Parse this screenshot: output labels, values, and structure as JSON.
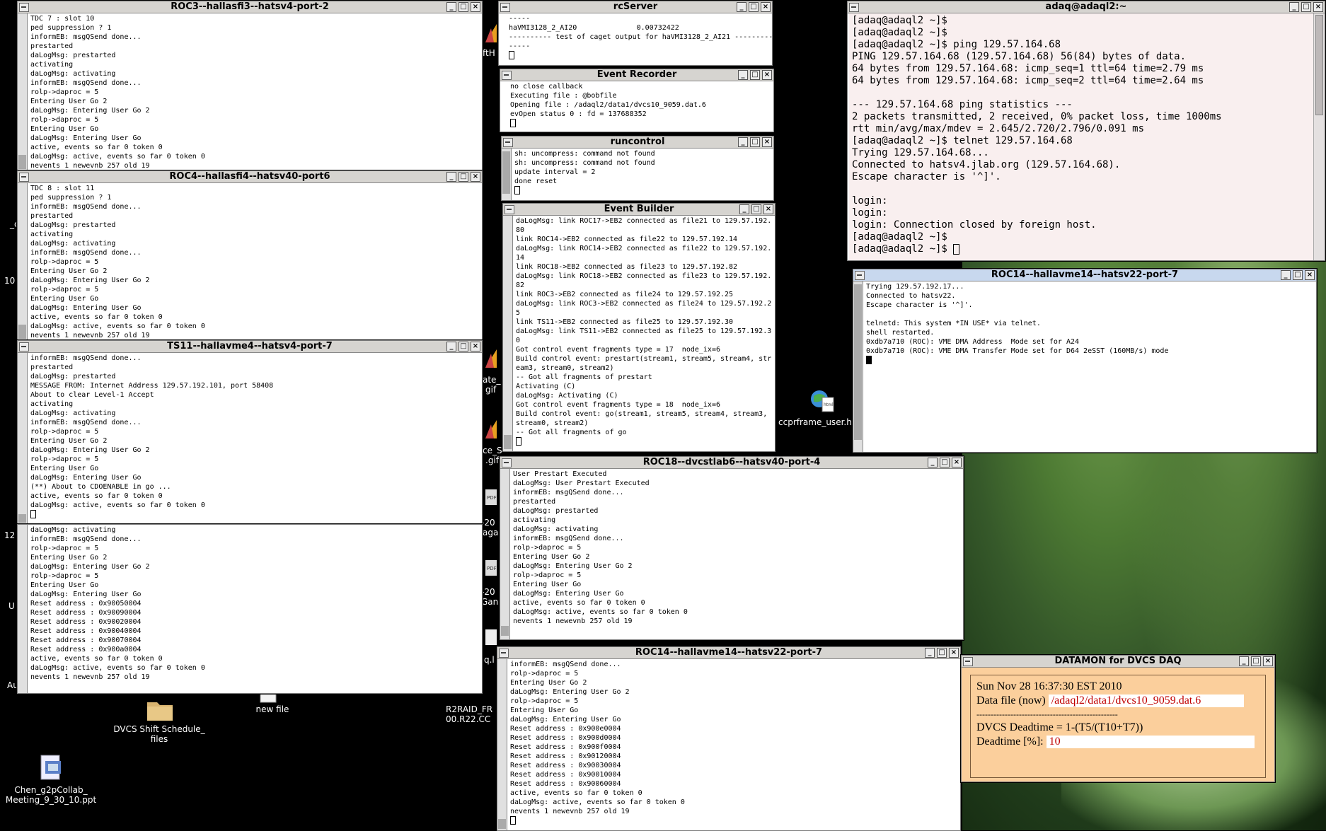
{
  "desktop": {
    "icons": [
      {
        "label": "DVCS Shift Schedule_\nfiles",
        "icon": "folder-icon"
      },
      {
        "label": "new file",
        "icon": "file-icon"
      },
      {
        "label": "Chen_g2pCollab_\nMeeting_9_30_10.ppt",
        "icon": "ppt-icon"
      },
      {
        "label": "ccprframe_user.h",
        "icon": "html-file-icon"
      },
      {
        "label": "R2RAID_FR\n00.R22.CC",
        "icon": "file-icon"
      }
    ],
    "partial_labels": [
      "ftH",
      "_c",
      "10",
      "12",
      "U",
      "Au",
      "ate_",
      "gif",
      "ce_S",
      ".gif",
      "-20",
      "aga",
      "-20",
      "Gan",
      "q.l"
    ]
  },
  "roc3": {
    "title": "ROC3--hallasfi3--hatsv4-port-2",
    "lines": "TDC 7 : slot 10\nped suppression ? 1\ninformEB: msgQSend done...\nprestarted\ndaLogMsg: prestarted\nactivating\ndaLogMsg: activating\ninformEB: msgQSend done...\nrolp->daproc = 5\nEntering User Go 2\ndaLogMsg: Entering User Go 2\nrolp->daproc = 5\nEntering User Go\ndaLogMsg: Entering User Go\nactive, events so far 0 token 0\ndaLogMsg: active, events so far 0 token 0\nnevents 1 newevnb 257 old 19"
  },
  "roc4": {
    "title": "ROC4--hallasfi4--hatsv40-port6",
    "lines": "TDC 8 : slot 11\nped suppression ? 1\ninformEB: msgQSend done...\nprestarted\ndaLogMsg: prestarted\nactivating\ndaLogMsg: activating\ninformEB: msgQSend done...\nrolp->daproc = 5\nEntering User Go 2\ndaLogMsg: Entering User Go 2\nrolp->daproc = 5\nEntering User Go\ndaLogMsg: Entering User Go\nactive, events so far 0 token 0\ndaLogMsg: active, events so far 0 token 0\nnevents 1 newevnb 257 old 19"
  },
  "ts11": {
    "title": "TS11--hallavme4--hatsv4-port-7",
    "lines": "informEB: msgQSend done...\nprestarted\ndaLogMsg: prestarted\nMESSAGE FROM: Internet Address 129.57.192.101, port 58408\nAbout to clear Level-1 Accept\nactivating\ndaLogMsg: activating\ninformEB: msgQSend done...\nrolp->daproc = 5\nEntering User Go 2\ndaLogMsg: Entering User Go 2\nrolp->daproc = 5\nEntering User Go\ndaLogMsg: Entering User Go\n(**) About to CDOENABLE in go ...\nactive, events so far 0 token 0\ndaLogMsg: active, events so far 0 token 0"
  },
  "lowerleft": {
    "lines": "daLogMsg: activating\ninformEB: msgQSend done...\nrolp->daproc = 5\nEntering User Go 2\ndaLogMsg: Entering User Go 2\nrolp->daproc = 5\nEntering User Go\ndaLogMsg: Entering User Go\nReset address : 0x90050004\nReset address : 0x90090004\nReset address : 0x90020004\nReset address : 0x90040004\nReset address : 0x90070004\nReset address : 0x900a0004\nactive, events so far 0 token 0\ndaLogMsg: active, events so far 0 token 0\nnevents 1 newevnb 257 old 19"
  },
  "rcserver": {
    "title": "rcServer",
    "lines": "-----\nhaVMI3128_2_AI20              0.00732422\n---------- test of caget output for haVMI3128_2_AI21 ---------\n-----"
  },
  "recorder": {
    "title": "Event Recorder",
    "lines": "no close callback\nExecuting file : @bobfile\nOpening file : /adaql2/data1/dvcs10_9059.dat.6\nevOpen status 0 : fd = 137688352"
  },
  "runcontrol": {
    "title": "runcontrol",
    "lines": "sh: uncompress: command not found\nsh: uncompress: command not found\nupdate interval = 2\ndone reset"
  },
  "eb": {
    "title": "Event Builder",
    "lines": "daLogMsg: link ROC17->EB2 connected as file21 to 129.57.192.\n80\nlink ROC14->EB2 connected as file22 to 129.57.192.14\ndaLogMsg: link ROC14->EB2 connected as file22 to 129.57.192.\n14\nlink ROC18->EB2 connected as file23 to 129.57.192.82\ndaLogMsg: link ROC18->EB2 connected as file23 to 129.57.192.\n82\nlink ROC3->EB2 connected as file24 to 129.57.192.25\ndaLogMsg: link ROC3->EB2 connected as file24 to 129.57.192.2\n5\nlink TS11->EB2 connected as file25 to 129.57.192.30\ndaLogMsg: link TS11->EB2 connected as file25 to 129.57.192.3\n0\nGot control event fragments type = 17  node_ix=6\nBuild control event: prestart(stream1, stream5, stream4, str\neam3, stream0, stream2)\n-- Got all fragments of prestart\nActivating (C)\ndaLogMsg: Activating (C)\nGot control event fragments type = 18  node_ix=6\nBuild control event: go(stream1, stream5, stream4, stream3,\nstream0, stream2)\n-- Got all fragments of go"
  },
  "roc18": {
    "title": "ROC18--dvcstlab6--hatsv40-port-4",
    "lines": "User Prestart Executed\ndaLogMsg: User Prestart Executed\ninformEB: msgQSend done...\nprestarted\ndaLogMsg: prestarted\nactivating\ndaLogMsg: activating\ninformEB: msgQSend done...\nrolp->daproc = 5\nEntering User Go 2\ndaLogMsg: Entering User Go 2\nrolp->daproc = 5\nEntering User Go\ndaLogMsg: Entering User Go\nactive, events so far 0 token 0\ndaLogMsg: active, events so far 0 token 0\nnevents 1 newevnb 257 old 19"
  },
  "roc14b": {
    "title": "ROC14--hallavme14--hatsv22-port-7",
    "lines": "informEB: msgQSend done...\nrolp->daproc = 5\nEntering User Go 2\ndaLogMsg: Entering User Go 2\nrolp->daproc = 5\nEntering User Go\ndaLogMsg: Entering User Go\nReset address : 0x900e0004\nReset address : 0x900d0004\nReset address : 0x900f0004\nReset address : 0x90120004\nReset address : 0x90030004\nReset address : 0x90010004\nReset address : 0x90060004\nactive, events so far 0 token 0\ndaLogMsg: active, events so far 0 token 0\nnevents 1 newevnb 257 old 19"
  },
  "adaq": {
    "title": "adaq@adaql2:~",
    "lines": "[adaq@adaql2 ~]$\n[adaq@adaql2 ~]$\n[adaq@adaql2 ~]$ ping 129.57.164.68\nPING 129.57.164.68 (129.57.164.68) 56(84) bytes of data.\n64 bytes from 129.57.164.68: icmp_seq=1 ttl=64 time=2.79 ms\n64 bytes from 129.57.164.68: icmp_seq=2 ttl=64 time=2.64 ms\n\n--- 129.57.164.68 ping statistics ---\n2 packets transmitted, 2 received, 0% packet loss, time 1000ms\nrtt min/avg/max/mdev = 2.645/2.720/2.796/0.091 ms\n[adaq@adaql2 ~]$ telnet 129.57.164.68\nTrying 129.57.164.68...\nConnected to hatsv4.jlab.org (129.57.164.68).\nEscape character is '^]'.\n\nlogin:\nlogin:\nlogin: Connection closed by foreign host.\n[adaq@adaql2 ~]$\n[adaq@adaql2 ~]$ "
  },
  "roc14a": {
    "title": "ROC14--hallavme14--hatsv22-port-7",
    "lines": "Trying 129.57.192.17...\nConnected to hatsv22.\nEscape character is '^]'.\n\ntelnetd: This system *IN USE* via telnet.\nshell restarted.\n0xdb7a710 (ROC): VME DMA Address  Mode set for A24\n0xdb7a710 (ROC): VME DMA Transfer Mode set for D64 2eSST (160MB/s) mode"
  },
  "datamon": {
    "title": "DATAMON  for DVCS DAQ",
    "datetime": "Sun Nov 28 16:37:30 EST 2010",
    "datafile_label": "Data file (now)",
    "datafile_value": "/adaql2/data1/dvcs10_9059.dat.6",
    "divider": "--------------------------------------------------",
    "deadtime_formula": "DVCS Deadtime = 1-(T5/(T10+T7))",
    "deadtime_label": "Deadtime [%]:",
    "deadtime_value": "10"
  },
  "controls": {
    "minimize": "_",
    "maximize": "□",
    "close": "×"
  },
  "colors": {
    "datamon_bg": "#fbcf9c",
    "datamon_value": "#c00000",
    "adaq_bg": "#f9efef"
  }
}
